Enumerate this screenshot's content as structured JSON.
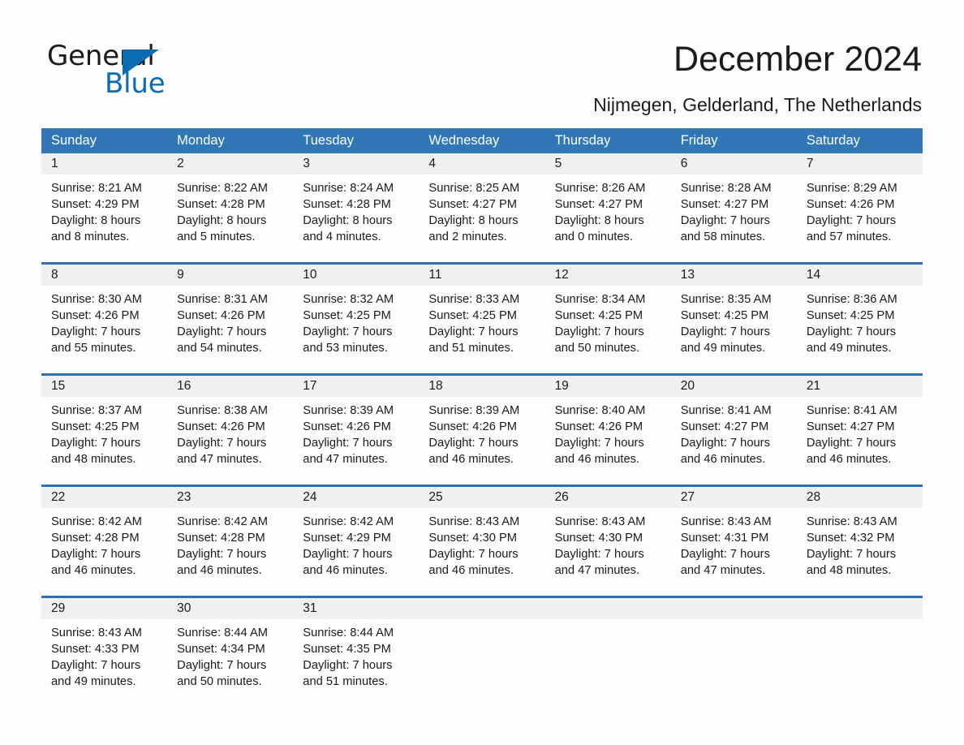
{
  "brand": {
    "name_part1": "General",
    "name_part2": "Blue",
    "triangle_color": "#0a6cb4"
  },
  "header": {
    "title": "December 2024",
    "subtitle": "Nijmegen, Gelderland, The Netherlands"
  },
  "colors": {
    "header_blue": "#3177b8",
    "row_rule_blue": "#2f6fad",
    "daynum_band": "#f0f0f0",
    "text": "#1b1b1b"
  },
  "calendar": {
    "weekday_headers": [
      "Sunday",
      "Monday",
      "Tuesday",
      "Wednesday",
      "Thursday",
      "Friday",
      "Saturday"
    ],
    "weeks": [
      [
        {
          "day": "1",
          "lines": [
            "Sunrise: 8:21 AM",
            "Sunset: 4:29 PM",
            "Daylight: 8 hours",
            "and 8 minutes."
          ]
        },
        {
          "day": "2",
          "lines": [
            "Sunrise: 8:22 AM",
            "Sunset: 4:28 PM",
            "Daylight: 8 hours",
            "and 5 minutes."
          ]
        },
        {
          "day": "3",
          "lines": [
            "Sunrise: 8:24 AM",
            "Sunset: 4:28 PM",
            "Daylight: 8 hours",
            "and 4 minutes."
          ]
        },
        {
          "day": "4",
          "lines": [
            "Sunrise: 8:25 AM",
            "Sunset: 4:27 PM",
            "Daylight: 8 hours",
            "and 2 minutes."
          ]
        },
        {
          "day": "5",
          "lines": [
            "Sunrise: 8:26 AM",
            "Sunset: 4:27 PM",
            "Daylight: 8 hours",
            "and 0 minutes."
          ]
        },
        {
          "day": "6",
          "lines": [
            "Sunrise: 8:28 AM",
            "Sunset: 4:27 PM",
            "Daylight: 7 hours",
            "and 58 minutes."
          ]
        },
        {
          "day": "7",
          "lines": [
            "Sunrise: 8:29 AM",
            "Sunset: 4:26 PM",
            "Daylight: 7 hours",
            "and 57 minutes."
          ]
        }
      ],
      [
        {
          "day": "8",
          "lines": [
            "Sunrise: 8:30 AM",
            "Sunset: 4:26 PM",
            "Daylight: 7 hours",
            "and 55 minutes."
          ]
        },
        {
          "day": "9",
          "lines": [
            "Sunrise: 8:31 AM",
            "Sunset: 4:26 PM",
            "Daylight: 7 hours",
            "and 54 minutes."
          ]
        },
        {
          "day": "10",
          "lines": [
            "Sunrise: 8:32 AM",
            "Sunset: 4:25 PM",
            "Daylight: 7 hours",
            "and 53 minutes."
          ]
        },
        {
          "day": "11",
          "lines": [
            "Sunrise: 8:33 AM",
            "Sunset: 4:25 PM",
            "Daylight: 7 hours",
            "and 51 minutes."
          ]
        },
        {
          "day": "12",
          "lines": [
            "Sunrise: 8:34 AM",
            "Sunset: 4:25 PM",
            "Daylight: 7 hours",
            "and 50 minutes."
          ]
        },
        {
          "day": "13",
          "lines": [
            "Sunrise: 8:35 AM",
            "Sunset: 4:25 PM",
            "Daylight: 7 hours",
            "and 49 minutes."
          ]
        },
        {
          "day": "14",
          "lines": [
            "Sunrise: 8:36 AM",
            "Sunset: 4:25 PM",
            "Daylight: 7 hours",
            "and 49 minutes."
          ]
        }
      ],
      [
        {
          "day": "15",
          "lines": [
            "Sunrise: 8:37 AM",
            "Sunset: 4:25 PM",
            "Daylight: 7 hours",
            "and 48 minutes."
          ]
        },
        {
          "day": "16",
          "lines": [
            "Sunrise: 8:38 AM",
            "Sunset: 4:26 PM",
            "Daylight: 7 hours",
            "and 47 minutes."
          ]
        },
        {
          "day": "17",
          "lines": [
            "Sunrise: 8:39 AM",
            "Sunset: 4:26 PM",
            "Daylight: 7 hours",
            "and 47 minutes."
          ]
        },
        {
          "day": "18",
          "lines": [
            "Sunrise: 8:39 AM",
            "Sunset: 4:26 PM",
            "Daylight: 7 hours",
            "and 46 minutes."
          ]
        },
        {
          "day": "19",
          "lines": [
            "Sunrise: 8:40 AM",
            "Sunset: 4:26 PM",
            "Daylight: 7 hours",
            "and 46 minutes."
          ]
        },
        {
          "day": "20",
          "lines": [
            "Sunrise: 8:41 AM",
            "Sunset: 4:27 PM",
            "Daylight: 7 hours",
            "and 46 minutes."
          ]
        },
        {
          "day": "21",
          "lines": [
            "Sunrise: 8:41 AM",
            "Sunset: 4:27 PM",
            "Daylight: 7 hours",
            "and 46 minutes."
          ]
        }
      ],
      [
        {
          "day": "22",
          "lines": [
            "Sunrise: 8:42 AM",
            "Sunset: 4:28 PM",
            "Daylight: 7 hours",
            "and 46 minutes."
          ]
        },
        {
          "day": "23",
          "lines": [
            "Sunrise: 8:42 AM",
            "Sunset: 4:28 PM",
            "Daylight: 7 hours",
            "and 46 minutes."
          ]
        },
        {
          "day": "24",
          "lines": [
            "Sunrise: 8:42 AM",
            "Sunset: 4:29 PM",
            "Daylight: 7 hours",
            "and 46 minutes."
          ]
        },
        {
          "day": "25",
          "lines": [
            "Sunrise: 8:43 AM",
            "Sunset: 4:30 PM",
            "Daylight: 7 hours",
            "and 46 minutes."
          ]
        },
        {
          "day": "26",
          "lines": [
            "Sunrise: 8:43 AM",
            "Sunset: 4:30 PM",
            "Daylight: 7 hours",
            "and 47 minutes."
          ]
        },
        {
          "day": "27",
          "lines": [
            "Sunrise: 8:43 AM",
            "Sunset: 4:31 PM",
            "Daylight: 7 hours",
            "and 47 minutes."
          ]
        },
        {
          "day": "28",
          "lines": [
            "Sunrise: 8:43 AM",
            "Sunset: 4:32 PM",
            "Daylight: 7 hours",
            "and 48 minutes."
          ]
        }
      ],
      [
        {
          "day": "29",
          "lines": [
            "Sunrise: 8:43 AM",
            "Sunset: 4:33 PM",
            "Daylight: 7 hours",
            "and 49 minutes."
          ]
        },
        {
          "day": "30",
          "lines": [
            "Sunrise: 8:44 AM",
            "Sunset: 4:34 PM",
            "Daylight: 7 hours",
            "and 50 minutes."
          ]
        },
        {
          "day": "31",
          "lines": [
            "Sunrise: 8:44 AM",
            "Sunset: 4:35 PM",
            "Daylight: 7 hours",
            "and 51 minutes."
          ]
        },
        {
          "day": "",
          "lines": []
        },
        {
          "day": "",
          "lines": []
        },
        {
          "day": "",
          "lines": []
        },
        {
          "day": "",
          "lines": []
        }
      ]
    ]
  }
}
